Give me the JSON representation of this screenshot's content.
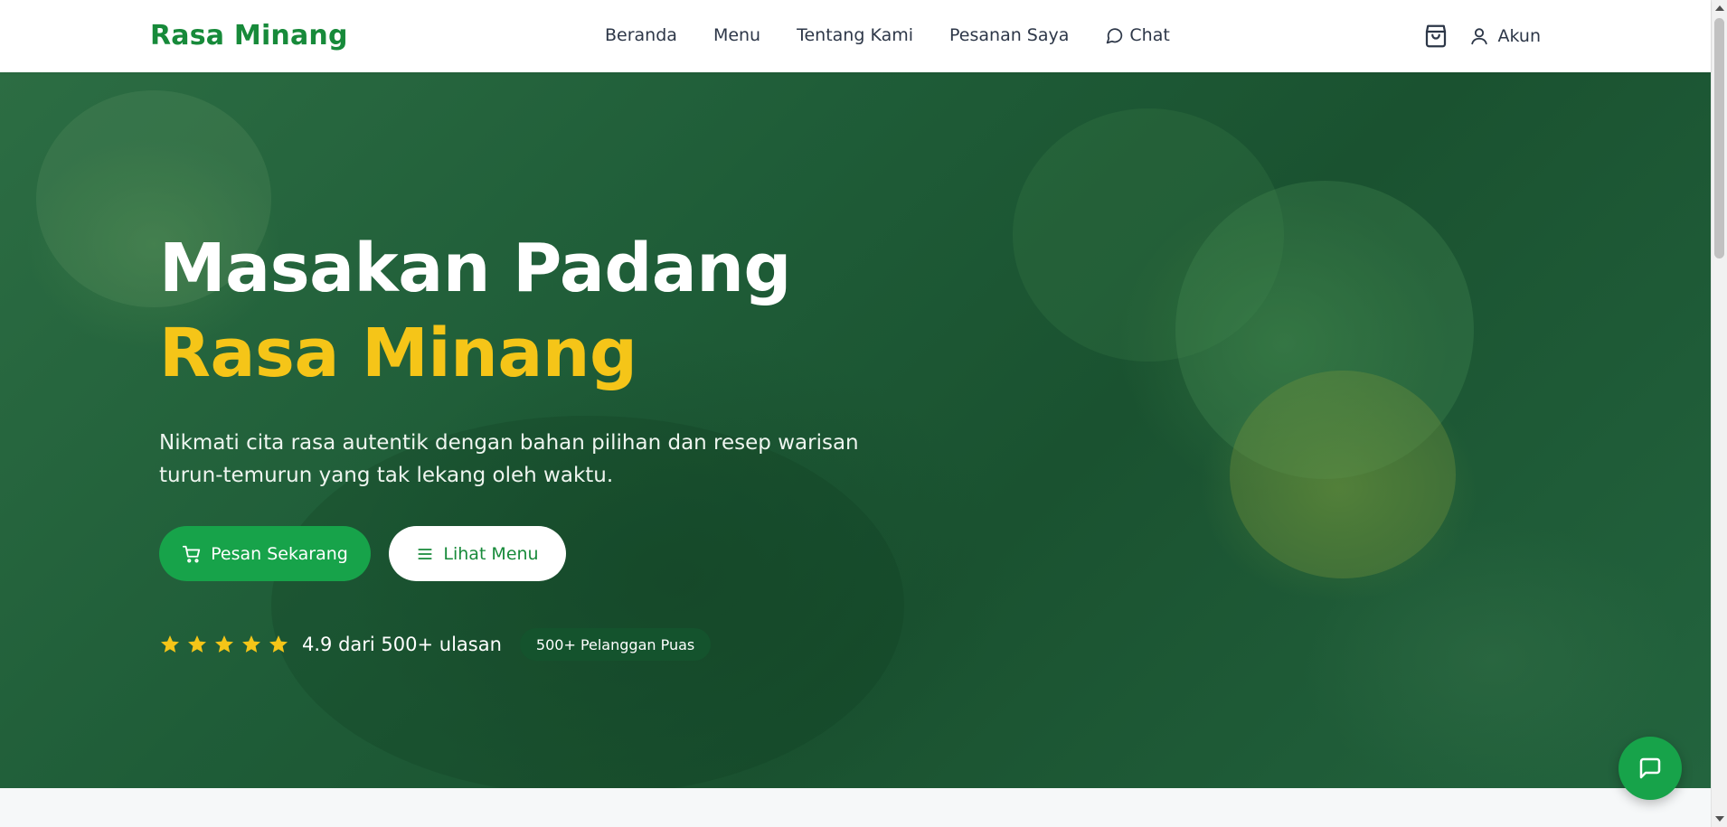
{
  "brand": {
    "name": "Rasa Minang",
    "color": "#178a3a"
  },
  "nav": {
    "items": [
      {
        "label": "Beranda"
      },
      {
        "label": "Menu"
      },
      {
        "label": "Tentang Kami"
      },
      {
        "label": "Pesanan Saya"
      },
      {
        "label": "Chat",
        "icon": "chat-bubble-icon"
      }
    ]
  },
  "header_right": {
    "cart_icon": "shopping-bag-icon",
    "account_label": "Akun",
    "account_icon": "user-icon"
  },
  "hero": {
    "title_part1": "Masakan Padang",
    "title_accent": "Rasa Minang",
    "accent_color": "#f5c518",
    "subtitle": "Nikmati cita rasa autentik dengan bahan pilihan dan resep warisan turun-temurun yang tak lekang oleh waktu.",
    "primary_button": {
      "label": "Pesan Sekarang",
      "icon": "cart-icon"
    },
    "secondary_button": {
      "label": "Lihat Menu",
      "icon": "menu-lines-icon"
    },
    "rating": {
      "stars": 5,
      "text": "4.9 dari 500+ ulasan"
    },
    "badge": "500+ Pelanggan Puas"
  },
  "chat_fab": {
    "icon": "chat-icon"
  },
  "colors": {
    "primary": "#17a34a",
    "hero_bg": "#1f5d38",
    "star": "#f5c518"
  }
}
